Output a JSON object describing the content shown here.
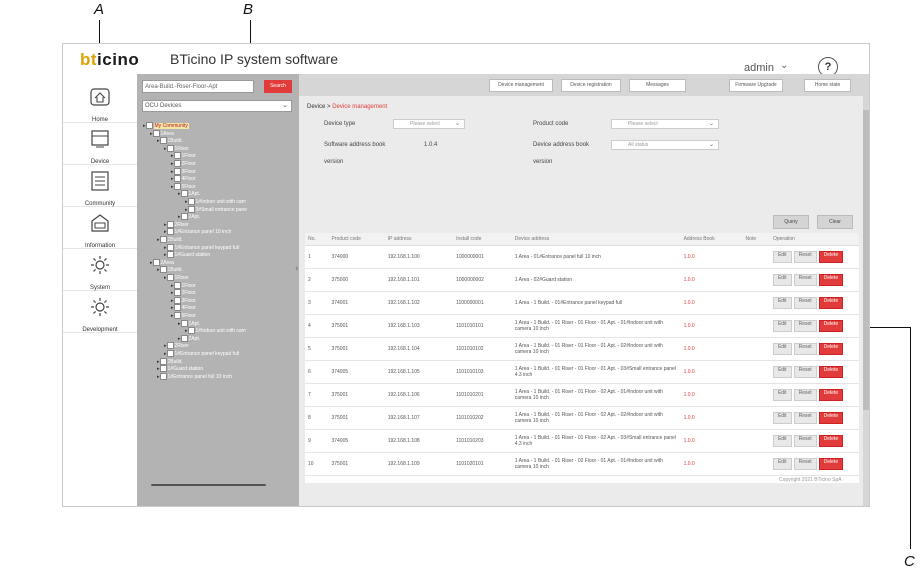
{
  "callouts": {
    "a": "A",
    "b": "B",
    "c": "C"
  },
  "header": {
    "logo_b": "bt",
    "logo_rest": "icino",
    "title": "BTicino IP system software",
    "user": "admin",
    "help": "?"
  },
  "nav": [
    {
      "label": "Home",
      "icon": "home-icon"
    },
    {
      "label": "Device",
      "icon": "device-icon"
    },
    {
      "label": "Community",
      "icon": "community-icon"
    },
    {
      "label": "Information",
      "icon": "information-icon"
    },
    {
      "label": "System",
      "icon": "gear-icon"
    },
    {
      "label": "Development",
      "icon": "gear-icon"
    }
  ],
  "tree_panel": {
    "search_placeholder": "Area-Build.-Riser-Floor-Apt",
    "search_button": "Search",
    "device_select": "OCU Devices",
    "nodes": [
      "My Community",
      "1Area",
      "1Build.",
      "1Riser",
      "1Floor",
      "2Floor",
      "3Floor",
      "4Floor",
      "5Floor",
      "1Apt.",
      "1#Indoor unit with cam",
      "2#Small entrance pane",
      "2Apt.",
      "2Riser",
      "1#Entrance panel 10 inch",
      "2Build.",
      "1#Entrance panel keypad full",
      "1#Guard station",
      "2Area",
      "1Build.",
      "1Riser",
      "1Floor",
      "2Floor",
      "3Floor",
      "4Floor",
      "5Floor",
      "1Apt.",
      "1#Indoor unit with cam",
      "2Apt.",
      "2Riser",
      "1#Entrance panel keypad full",
      "2Build.",
      "1#Guard station",
      "1#Entrance panel full 10 inch"
    ]
  },
  "toolbar": [
    "Device management",
    "Device registration",
    "Messages",
    "Firmware Upgrade",
    "Home state"
  ],
  "breadcrumb": {
    "root": "Device",
    "current": "Device management"
  },
  "filters": {
    "device_type_label": "Device type",
    "device_type_value": "Please select",
    "product_code_label": "Product code",
    "product_code_value": "Please select",
    "sw_addr_label": "Software address book",
    "sw_addr_label2": "version",
    "sw_addr_value": "1.0.4",
    "dev_addr_label": "Device address book",
    "dev_addr_label2": "version",
    "dev_addr_value": "All status",
    "query": "Query",
    "clear": "Clear"
  },
  "table": {
    "headers": [
      "No.",
      "Product code",
      "IP address",
      "Install code",
      "Device address",
      "Address Book",
      "Note",
      "Operation"
    ],
    "op_edit": "Edit",
    "op_reset": "Reset",
    "op_delete": "Delete",
    "rows": [
      {
        "no": "1",
        "code": "374000",
        "ip": "192.168.1.100",
        "install": "1000000001",
        "addr": "1 Area - 01#Entrance panel full 10 inch",
        "book": "1.0.0"
      },
      {
        "no": "2",
        "code": "375000",
        "ip": "192.168.1.101",
        "install": "1000000002",
        "addr": "1 Area - 02#Guard station",
        "book": "1.0.0"
      },
      {
        "no": "3",
        "code": "374001",
        "ip": "192.168.1.102",
        "install": "1100000001",
        "addr": "1 Area - 1 Build. - 01#Entrance panel keypad full",
        "book": "1.0.0"
      },
      {
        "no": "4",
        "code": "375001",
        "ip": "192.168.1.103",
        "install": "1101010101",
        "addr": "1 Area - 1 Build. - 01 Riser - 01 Floor - 01 Apt. - 01#Indoor unit with camera 10 inch",
        "book": "1.0.0"
      },
      {
        "no": "5",
        "code": "375001",
        "ip": "192.168.1.104",
        "install": "1101010102",
        "addr": "1 Area - 1 Build. - 01 Riser - 01 Floor - 01 Apt. - 02#Indoor unit with camera 10 inch",
        "book": "1.0.0"
      },
      {
        "no": "6",
        "code": "374005",
        "ip": "192.168.1.105",
        "install": "1101010103",
        "addr": "1 Area - 1 Build. - 01 Riser - 01 Floor - 01 Apt. - 03#Small entrance panel 4.3 inch",
        "book": "1.0.0"
      },
      {
        "no": "7",
        "code": "375001",
        "ip": "192.168.1.106",
        "install": "1101010201",
        "addr": "1 Area - 1 Build. - 01 Riser - 01 Floor - 02 Apt. - 01#Indoor unit with camera 10 inch",
        "book": "1.0.0"
      },
      {
        "no": "8",
        "code": "375001",
        "ip": "192.168.1.107",
        "install": "1101010202",
        "addr": "1 Area - 1 Build. - 01 Riser - 01 Floor - 02 Apt. - 02#Indoor unit with camera 10 inch",
        "book": "1.0.0"
      },
      {
        "no": "9",
        "code": "374005",
        "ip": "192.168.1.108",
        "install": "1101010203",
        "addr": "1 Area - 1 Build. - 01 Riser - 01 Floor - 02 Apt. - 03#Small entrance panel 4.3 inch",
        "book": "1.0.0"
      },
      {
        "no": "10",
        "code": "375001",
        "ip": "192.168.1.109",
        "install": "1101020101",
        "addr": "1 Area - 1 Build. - 01 Riser - 02 Floor - 01 Apt. - 01#Indoor unit with camera 10 inch",
        "book": "1.0.0"
      }
    ]
  },
  "footer": {
    "copyright": "Copyright 2021 BTicino SpA"
  },
  "colors": {
    "accent": "#e23b3b",
    "tree_bg": "#b3b3b3",
    "main_bg": "#ebebeb"
  }
}
